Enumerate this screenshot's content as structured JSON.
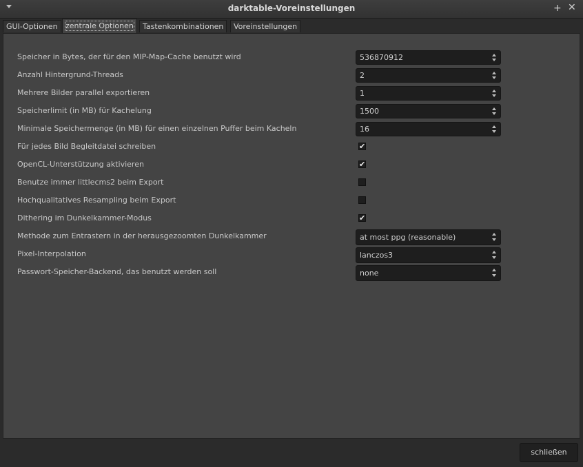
{
  "window": {
    "title": "darktable-Voreinstellungen",
    "icons": {
      "menu": "chevron-down-icon",
      "maximize": "maximize-icon",
      "close": "close-icon"
    }
  },
  "tabs": [
    {
      "label": "GUI-Optionen",
      "active": false
    },
    {
      "label": "zentrale Optionen",
      "active": true
    },
    {
      "label": "Tastenkombinationen",
      "active": false
    },
    {
      "label": "Voreinstellungen",
      "active": false
    }
  ],
  "settings": [
    {
      "label": "Speicher in Bytes, der für den MIP-Map-Cache benutzt wird",
      "type": "spin",
      "value": "536870912"
    },
    {
      "label": "Anzahl Hintergrund-Threads",
      "type": "spin",
      "value": "2"
    },
    {
      "label": "Mehrere Bilder parallel exportieren",
      "type": "spin",
      "value": "1"
    },
    {
      "label": "Speicherlimit (in MB) für Kachelung",
      "type": "spin",
      "value": "1500"
    },
    {
      "label": "Minimale Speichermenge (in MB) für einen einzelnen Puffer beim Kacheln",
      "type": "spin",
      "value": "16"
    },
    {
      "label": "Für jedes Bild Begleitdatei schreiben",
      "type": "check",
      "checked": true
    },
    {
      "label": "OpenCL-Unterstützung aktivieren",
      "type": "check",
      "checked": true
    },
    {
      "label": "Benutze immer littlecms2 beim Export",
      "type": "check",
      "checked": false
    },
    {
      "label": "Hochqualitatives Resampling beim Export",
      "type": "check",
      "checked": false
    },
    {
      "label": "Dithering im Dunkelkammer-Modus",
      "type": "check",
      "checked": true
    },
    {
      "label": "Methode zum Entrastern in der herausgezoomten Dunkelkammer",
      "type": "combo",
      "value": "at most ppg (reasonable)"
    },
    {
      "label": "Pixel-Interpolation",
      "type": "combo",
      "value": "lanczos3"
    },
    {
      "label": "Passwort-Speicher-Backend, das benutzt werden soll",
      "type": "combo",
      "value": "none"
    }
  ],
  "footer": {
    "close_label": "schließen"
  },
  "check_mark": "✔"
}
